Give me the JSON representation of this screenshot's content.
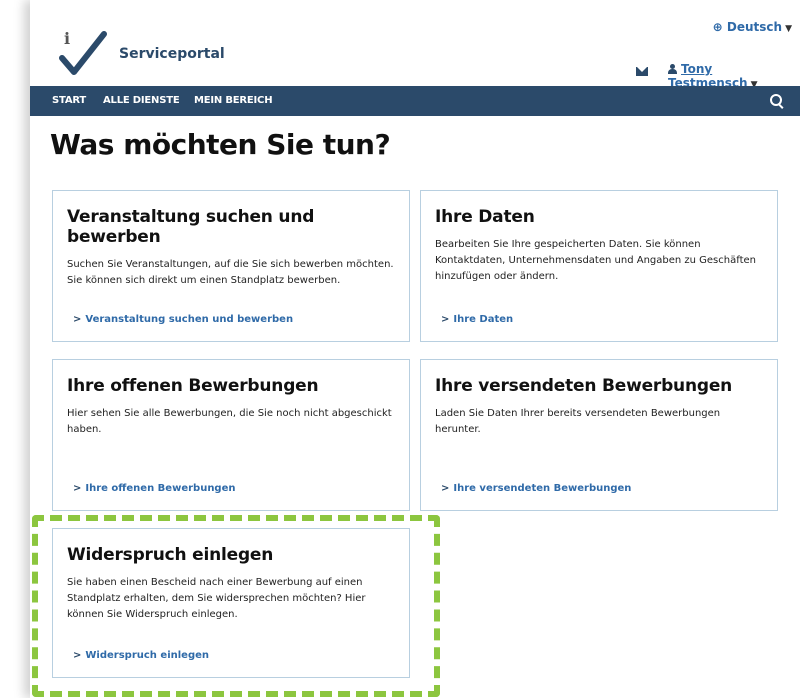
{
  "header": {
    "brand": "Serviceportal",
    "language": "Deutsch",
    "user_name": "Tony Testmensch"
  },
  "nav": {
    "items": [
      "START",
      "ALLE DIENSTE",
      "MEIN BEREICH"
    ]
  },
  "main": {
    "title": "Was möchten Sie tun?",
    "cards": [
      {
        "title": "Veranstaltung suchen und bewerben",
        "text": "Suchen Sie Veranstaltungen, auf die Sie sich bewerben möchten. Sie können sich direkt um einen Standplatz bewerben.",
        "link": "Veranstaltung suchen und bewerben"
      },
      {
        "title": "Ihre Daten",
        "text": "Bearbeiten Sie Ihre gespeicherten Daten. Sie können Kontaktdaten, Unternehmensdaten und Angaben zu Geschäften hinzufügen oder ändern.",
        "link": "Ihre Daten"
      },
      {
        "title": "Ihre offenen Bewerbungen",
        "text": "Hier sehen Sie alle Bewerbungen, die Sie noch nicht abgeschickt haben.",
        "link": "Ihre offenen Bewerbungen"
      },
      {
        "title": "Ihre versendeten Bewerbungen",
        "text": "Laden Sie Daten Ihrer bereits versendeten Bewerbungen herunter.",
        "link": "Ihre versendeten Bewerbungen"
      },
      {
        "title": "Widerspruch einlegen",
        "text": "Sie haben einen Bescheid nach einer Bewerbung auf einen Standplatz erhalten, dem Sie widersprechen möchten? Hier können Sie Widerspruch einlegen.",
        "link": "Widerspruch einlegen"
      }
    ]
  },
  "colors": {
    "nav_bg": "#2b4a6a",
    "link": "#2f6aa8",
    "card_border": "#b8cfe0",
    "highlight": "#8cc63f"
  },
  "icons": [
    "logo-check-icon",
    "globe-icon",
    "mail-icon",
    "user-icon",
    "search-icon",
    "chevron-right-icon"
  ]
}
